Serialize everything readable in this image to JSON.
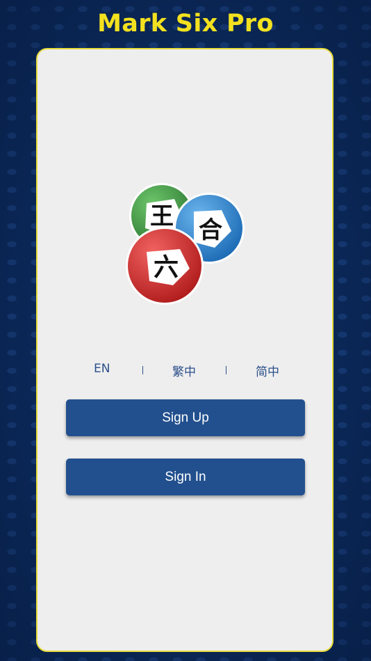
{
  "app": {
    "title": "Mark Six Pro"
  },
  "logo": {
    "balls": [
      "王",
      "合",
      "六"
    ]
  },
  "languages": [
    {
      "label": "EN"
    },
    {
      "label": "繁中"
    },
    {
      "label": "简中"
    }
  ],
  "actions": {
    "sign_up": "Sign Up",
    "sign_in": "Sign In"
  },
  "colors": {
    "background": "#0b2a5c",
    "title": "#f3e11f",
    "card": "#eeeeee",
    "card_border": "#e8dc3a",
    "button": "#22508e",
    "language_text": "#2b4f8a",
    "ball_green": "#4aa04a",
    "ball_blue": "#2f8fd8",
    "ball_red": "#d9312f"
  }
}
